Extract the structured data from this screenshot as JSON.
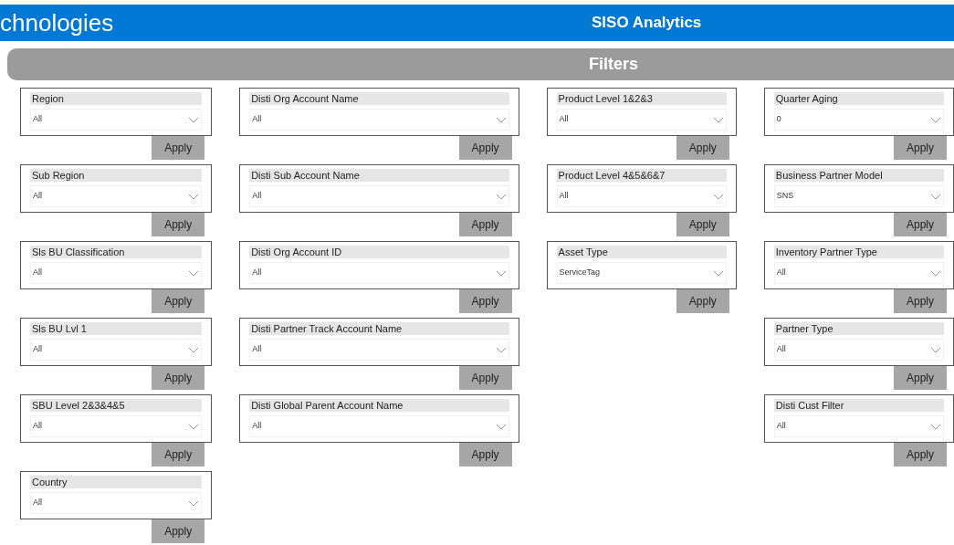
{
  "header": {
    "logo_text": "chnologies",
    "title": "SISO Analytics"
  },
  "filters_bar": {
    "title": "Filters"
  },
  "columns": [
    [
      {
        "label": "Region",
        "value": "All",
        "button": "Apply"
      },
      {
        "label": "Sub Region",
        "value": "All",
        "button": "Apply"
      },
      {
        "label": "Sls BU Classification",
        "value": "All",
        "button": "Apply"
      },
      {
        "label": "Sls BU Lvl 1",
        "value": "All",
        "button": "Apply"
      },
      {
        "label": "SBU Level 2&3&4&5",
        "value": "All",
        "button": "Apply"
      },
      {
        "label": "Country",
        "value": "All",
        "button": "Apply"
      }
    ],
    [
      {
        "label": "Disti Org Account Name",
        "value": "All",
        "button": "Apply"
      },
      {
        "label": "Disti Sub Account Name",
        "value": "All",
        "button": "Apply"
      },
      {
        "label": "Disti Org Account ID",
        "value": "All",
        "button": "Apply"
      },
      {
        "label": "Disti Partner Track Account Name",
        "value": "All",
        "button": "Apply"
      },
      {
        "label": "Disti Global Parent Account Name",
        "value": "All",
        "button": "Apply"
      }
    ],
    [
      {
        "label": "Product Level 1&2&3",
        "value": "All",
        "button": "Apply"
      },
      {
        "label": "Product Level 4&5&6&7",
        "value": "All",
        "button": "Apply"
      },
      {
        "label": "Asset Type",
        "value": "ServiceTag",
        "button": "Apply"
      }
    ],
    [
      {
        "label": "Quarter Aging",
        "value": "0",
        "button": "Apply"
      },
      {
        "label": "Business Partner Model",
        "value": "SNS",
        "button": "Apply"
      },
      {
        "label": "Inventory Partner Type",
        "value": "All",
        "button": "Apply"
      },
      {
        "label": "Partner Type",
        "value": "All",
        "button": "Apply"
      },
      {
        "label": "Disti Cust Filter",
        "value": "All",
        "button": "Apply"
      }
    ]
  ]
}
